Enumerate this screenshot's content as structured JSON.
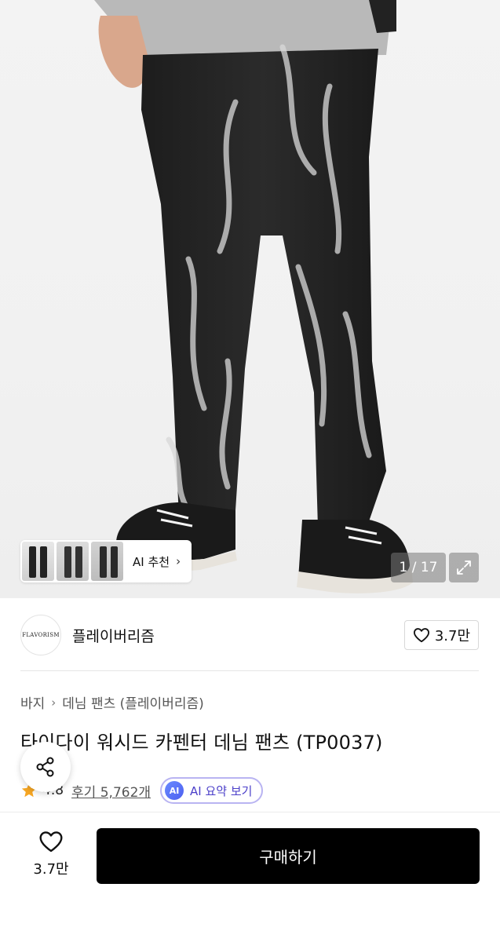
{
  "gallery": {
    "counter": "1 / 17",
    "ai_recommend_label": "AI 추천"
  },
  "brand": {
    "logo_text": "FLAVORISM",
    "name": "플레이버리즘",
    "like_count": "3.7만"
  },
  "breadcrumb": {
    "category": "바지",
    "subcategory": "데님 팬츠 (플레이버리즘)"
  },
  "product": {
    "title": "타이다이 워시드 카펜터 데님 팬츠 (TP0037)",
    "rating": "4.8",
    "reviews": "후기 5,762개",
    "ai_summary_label": "AI 요약 보기",
    "ai_badge": "AI"
  },
  "bottom_bar": {
    "like_count": "3.7만",
    "buy_label": "구매하기"
  },
  "colors": {
    "star": "#f6a623",
    "buy_button": "#000000",
    "ai_accent": "#4c5ff0"
  },
  "icons": [
    "heart-icon",
    "share-icon",
    "star-icon",
    "expand-icon",
    "chevron-right-icon"
  ]
}
